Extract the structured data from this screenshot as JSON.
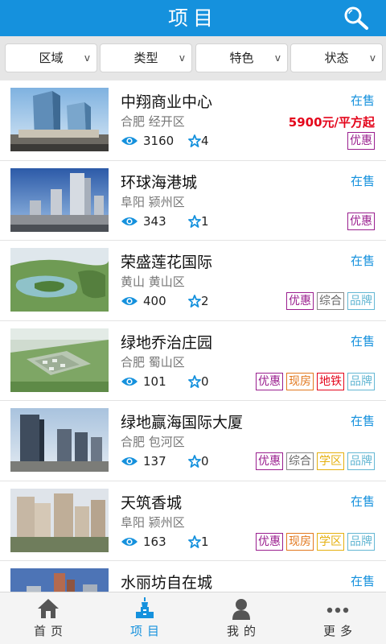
{
  "header": {
    "title": "项目",
    "search_icon": "magnifier-icon"
  },
  "filters": [
    {
      "label": "区域",
      "arrow": "v"
    },
    {
      "label": "类型",
      "arrow": "v"
    },
    {
      "label": "特色",
      "arrow": "v"
    },
    {
      "label": "状态",
      "arrow": "v"
    }
  ],
  "projects": [
    {
      "name": "中翔商业中心",
      "location": "合肥 经开区",
      "views": "3160",
      "favorites": "4",
      "status": "在售",
      "price": "5900元/平方起",
      "tags": [
        "优惠"
      ],
      "thumb": "commercial-towers-photo"
    },
    {
      "name": "环球海港城",
      "location": "阜阳 颍州区",
      "views": "343",
      "favorites": "1",
      "status": "在售",
      "tags": [
        "优惠"
      ],
      "thumb": "highrise-complex-photo"
    },
    {
      "name": "荣盛莲花国际",
      "location": "黄山 黄山区",
      "views": "400",
      "favorites": "2",
      "status": "在售",
      "tags": [
        "优惠",
        "综合",
        "品牌"
      ],
      "thumb": "aerial-lake-resort-photo"
    },
    {
      "name": "绿地乔治庄园",
      "location": "合肥 蜀山区",
      "views": "101",
      "favorites": "0",
      "status": "在售",
      "tags": [
        "优惠",
        "现房",
        "地铁",
        "品牌"
      ],
      "thumb": "aerial-villa-community-photo"
    },
    {
      "name": "绿地赢海国际大厦",
      "location": "合肥 包河区",
      "views": "137",
      "favorites": "0",
      "status": "在售",
      "tags": [
        "优惠",
        "综合",
        "学区",
        "品牌"
      ],
      "thumb": "office-towers-photo"
    },
    {
      "name": "天筑香城",
      "location": "阜阳 颍州区",
      "views": "163",
      "favorites": "1",
      "status": "在售",
      "tags": [
        "优惠",
        "现房",
        "学区",
        "品牌"
      ],
      "thumb": "residential-blocks-photo"
    },
    {
      "name": "水丽坊自在城",
      "location": "",
      "views": "",
      "favorites": "",
      "status": "在售",
      "tags": [],
      "thumb": "city-skyline-photo"
    }
  ],
  "bottom_nav": [
    {
      "label": "首页",
      "icon": "home-icon",
      "active": false
    },
    {
      "label": "项目",
      "icon": "tower-icon",
      "active": true
    },
    {
      "label": "我的",
      "icon": "user-icon",
      "active": false
    },
    {
      "label": "更多",
      "icon": "more-dots-icon",
      "active": false
    }
  ],
  "colors": {
    "header": "#1591dd",
    "status": "#1591dd",
    "price": "#e4051b",
    "tag_youhui": "#9a1f8f",
    "tag_zonghe": "#666666",
    "tag_pinpai": "#64b7d3",
    "tag_xianfang": "#e2781e",
    "tag_ditie": "#e4051b",
    "tag_xuequ": "#e5b00f"
  }
}
